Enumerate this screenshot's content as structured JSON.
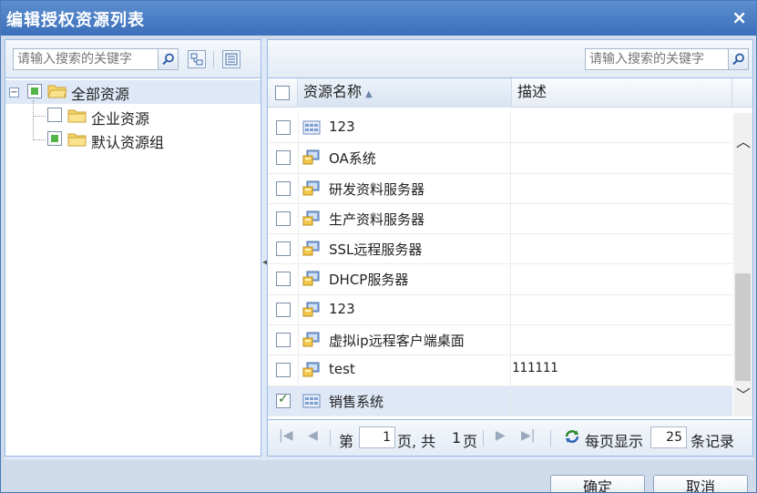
{
  "dialog": {
    "title": "编辑授权资源列表",
    "close_glyph": "×"
  },
  "left": {
    "search_placeholder": "请输入搜索的关键字",
    "tree": [
      {
        "label": "全部资源",
        "state": "partial",
        "expanded": true
      },
      {
        "label": "企业资源",
        "state": "unchecked"
      },
      {
        "label": "默认资源组",
        "state": "partial"
      }
    ]
  },
  "right": {
    "search_placeholder": "请输入搜索的关键字",
    "columns": {
      "name": "资源名称",
      "sort_glyph": "▲",
      "desc": "描述"
    },
    "rows": [
      {
        "name": "123",
        "desc": "",
        "icon": "app-grid-icon",
        "checked": false
      },
      {
        "name": "OA系统",
        "desc": "",
        "icon": "server-icon",
        "checked": false
      },
      {
        "name": "研发资料服务器",
        "desc": "",
        "icon": "server-icon",
        "checked": false
      },
      {
        "name": "生产资料服务器",
        "desc": "",
        "icon": "server-icon",
        "checked": false
      },
      {
        "name": "SSL远程服务器",
        "desc": "",
        "icon": "server-icon",
        "checked": false
      },
      {
        "name": "DHCP服务器",
        "desc": "",
        "icon": "server-icon",
        "checked": false
      },
      {
        "name": "123",
        "desc": "",
        "icon": "server-icon",
        "checked": false
      },
      {
        "name": "虚拟ip远程客户端桌面",
        "desc": "",
        "icon": "server-icon",
        "checked": false
      },
      {
        "name": "test",
        "desc": "111111",
        "icon": "server-icon",
        "checked": false
      },
      {
        "name": "销售系统",
        "desc": "",
        "icon": "app-grid-icon",
        "checked": true
      }
    ],
    "pager": {
      "page_prefix": "第",
      "page_value": "1",
      "page_suffix": "页, 共",
      "total_pages": "1",
      "pages_unit": "页",
      "per_page_label": "每页显示",
      "per_page_value": "25",
      "records_label": "条记录"
    }
  },
  "buttons": {
    "ok": "确定",
    "cancel": "取消"
  },
  "colors": {
    "titlebar": "#3b6fba",
    "panel_border": "#99bbe8",
    "selection": "#dfe8f6",
    "check_green": "#53b548"
  }
}
